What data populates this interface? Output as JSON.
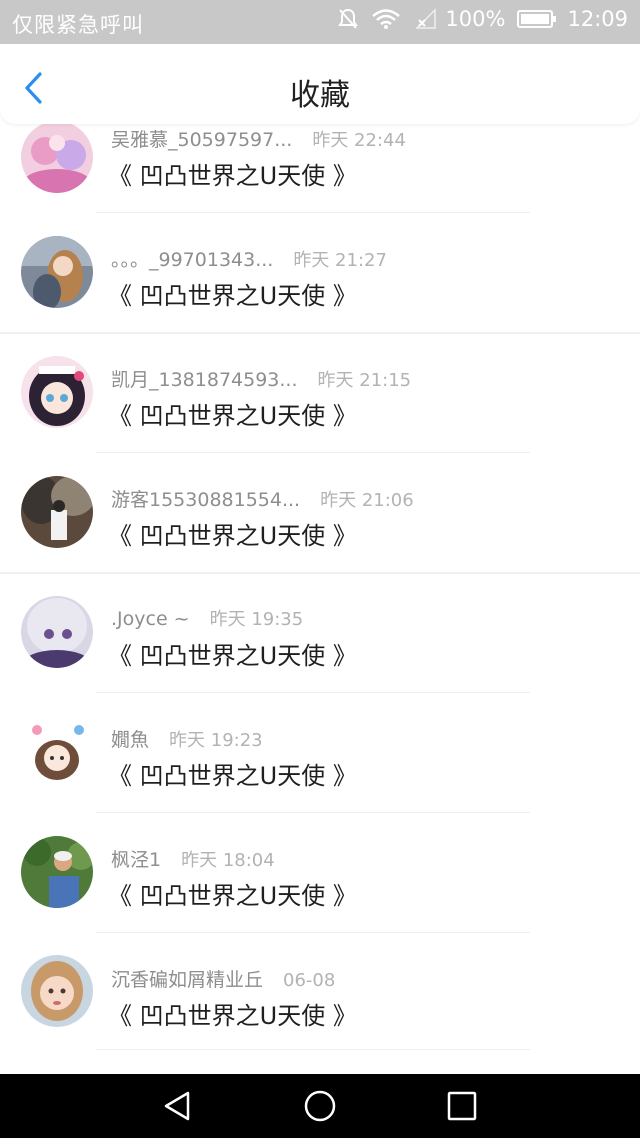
{
  "status_bar": {
    "carrier": "仅限紧急呼叫",
    "battery": "100%",
    "time": "12:09",
    "icons": [
      "mute-icon",
      "wifi-icon",
      "no-signal-icon",
      "battery-icon"
    ]
  },
  "header": {
    "title": "收藏",
    "back_icon": "chevron-left-icon",
    "accent_color": "#2d8cf0"
  },
  "items": [
    {
      "name": "吴雅慕_50597597...",
      "time": "昨天 22:44",
      "content": "《 凹凸世界之U天使 》"
    },
    {
      "name": "。。。_99701343...",
      "time": "昨天 21:27",
      "content": "《 凹凸世界之U天使 》"
    },
    {
      "name": "凯月_1381874593...",
      "time": "昨天 21:15",
      "content": "《 凹凸世界之U天使 》"
    },
    {
      "name": "游客15530881554...",
      "time": "昨天 21:06",
      "content": "《 凹凸世界之U天使 》"
    },
    {
      "name": ".Joyce ~",
      "time": "昨天 19:35",
      "content": "《 凹凸世界之U天使 》"
    },
    {
      "name": "嫺魚",
      "time": "昨天 19:23",
      "content": "《 凹凸世界之U天使 》"
    },
    {
      "name": "枫泾1",
      "time": "昨天 18:04",
      "content": "《 凹凸世界之U天使 》"
    },
    {
      "name": "沉香碥如屑精业丘",
      "time": "06-08",
      "content": "《 凹凸世界之U天使 》"
    }
  ],
  "nav_bar": {
    "icons": [
      "back-triangle-icon",
      "home-circle-icon",
      "recents-square-icon"
    ]
  }
}
